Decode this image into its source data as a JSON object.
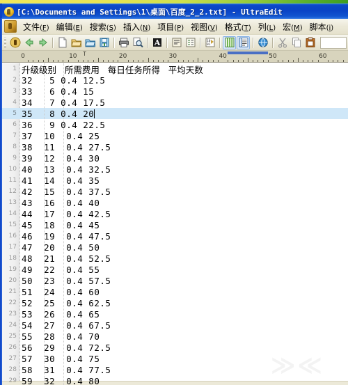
{
  "window": {
    "title": "[C:\\Documents and Settings\\1\\桌面\\百度_2_2.txt] - UltraEdit",
    "app_name": "UltraEdit",
    "icon": "ultraedit-app-icon"
  },
  "menubar": {
    "items": [
      {
        "label": "文件",
        "accel": "F"
      },
      {
        "label": "编辑",
        "accel": "E"
      },
      {
        "label": "搜索",
        "accel": "S"
      },
      {
        "label": "插入",
        "accel": "N"
      },
      {
        "label": "项目",
        "accel": "P"
      },
      {
        "label": "视图",
        "accel": "V"
      },
      {
        "label": "格式",
        "accel": "T"
      },
      {
        "label": "列",
        "accel": "L"
      },
      {
        "label": "宏",
        "accel": "M"
      },
      {
        "label": "脚本",
        "accel": "i"
      }
    ]
  },
  "toolbar": {
    "buttons": [
      {
        "name": "app-logo-icon",
        "glyph": "logo"
      },
      {
        "name": "back-arrow-icon",
        "glyph": "back"
      },
      {
        "name": "forward-arrow-icon",
        "glyph": "forward"
      },
      {
        "name": "new-file-icon",
        "glyph": "newfile"
      },
      {
        "name": "open-folder-icon",
        "glyph": "open"
      },
      {
        "name": "open-project-icon",
        "glyph": "openproj"
      },
      {
        "name": "save-icon",
        "glyph": "save"
      },
      {
        "name": "print-icon",
        "glyph": "print"
      },
      {
        "name": "print-preview-icon",
        "glyph": "preview"
      },
      {
        "name": "font-icon",
        "glyph": "font"
      },
      {
        "name": "word-wrap-icon",
        "glyph": "wrap"
      },
      {
        "name": "list-format-icon",
        "glyph": "listfmt"
      },
      {
        "name": "hex-edit-icon",
        "glyph": "hex"
      },
      {
        "name": "column-mode-icon",
        "glyph": "column",
        "active": true
      },
      {
        "name": "line-numbers-icon",
        "glyph": "linenum",
        "active": true
      },
      {
        "name": "browser-view-icon",
        "glyph": "globe"
      },
      {
        "name": "cut-icon",
        "glyph": "cut"
      },
      {
        "name": "copy-icon",
        "glyph": "copy"
      },
      {
        "name": "paste-icon",
        "glyph": "paste"
      }
    ]
  },
  "ruler": {
    "labels": [
      "0",
      "10",
      "20",
      "30",
      "40",
      "50",
      "60"
    ],
    "tab_marker": "T"
  },
  "editor": {
    "header_line": {
      "number": "1",
      "text": "升级级别   所需费用   每日任务所得   平均天数"
    },
    "selected_line_number": 5,
    "caret_after": "20",
    "rows": [
      {
        "number": "2",
        "text": "32   5 0.4 12.5"
      },
      {
        "number": "3",
        "text": "33   6 0.4 15"
      },
      {
        "number": "4",
        "text": "34   7 0.4 17.5"
      },
      {
        "number": "5",
        "text": "35   8 0.4 20"
      },
      {
        "number": "6",
        "text": "36   9 0.4 22.5"
      },
      {
        "number": "7",
        "text": "37  10  0.4 25"
      },
      {
        "number": "8",
        "text": "38  11  0.4 27.5"
      },
      {
        "number": "9",
        "text": "39  12  0.4 30"
      },
      {
        "number": "10",
        "text": "40  13  0.4 32.5"
      },
      {
        "number": "11",
        "text": "41  14  0.4 35"
      },
      {
        "number": "12",
        "text": "42  15  0.4 37.5"
      },
      {
        "number": "13",
        "text": "43  16  0.4 40"
      },
      {
        "number": "14",
        "text": "44  17  0.4 42.5"
      },
      {
        "number": "15",
        "text": "45  18  0.4 45"
      },
      {
        "number": "16",
        "text": "46  19  0.4 47.5"
      },
      {
        "number": "17",
        "text": "47  20  0.4 50"
      },
      {
        "number": "18",
        "text": "48  21  0.4 52.5"
      },
      {
        "number": "19",
        "text": "49  22  0.4 55"
      },
      {
        "number": "20",
        "text": "50  23  0.4 57.5"
      },
      {
        "number": "21",
        "text": "51  24  0.4 60"
      },
      {
        "number": "22",
        "text": "52  25  0.4 62.5"
      },
      {
        "number": "23",
        "text": "53  26  0.4 65"
      },
      {
        "number": "24",
        "text": "54  27  0.4 67.5"
      },
      {
        "number": "25",
        "text": "55  28  0.4 70"
      },
      {
        "number": "26",
        "text": "56  29  0.4 72.5"
      },
      {
        "number": "27",
        "text": "57  30  0.4 75"
      },
      {
        "number": "28",
        "text": "58  31  0.4 77.5"
      },
      {
        "number": "29",
        "text": "59  32  0.4 80"
      }
    ]
  },
  "colors": {
    "titlebar": "#0a44c6",
    "chrome": "#ece9d8",
    "selection": "#cfe7f8",
    "editor_bg": "#ffffff",
    "gutter_text": "#9a9a9a",
    "desktop_band": "#8fc93a"
  }
}
